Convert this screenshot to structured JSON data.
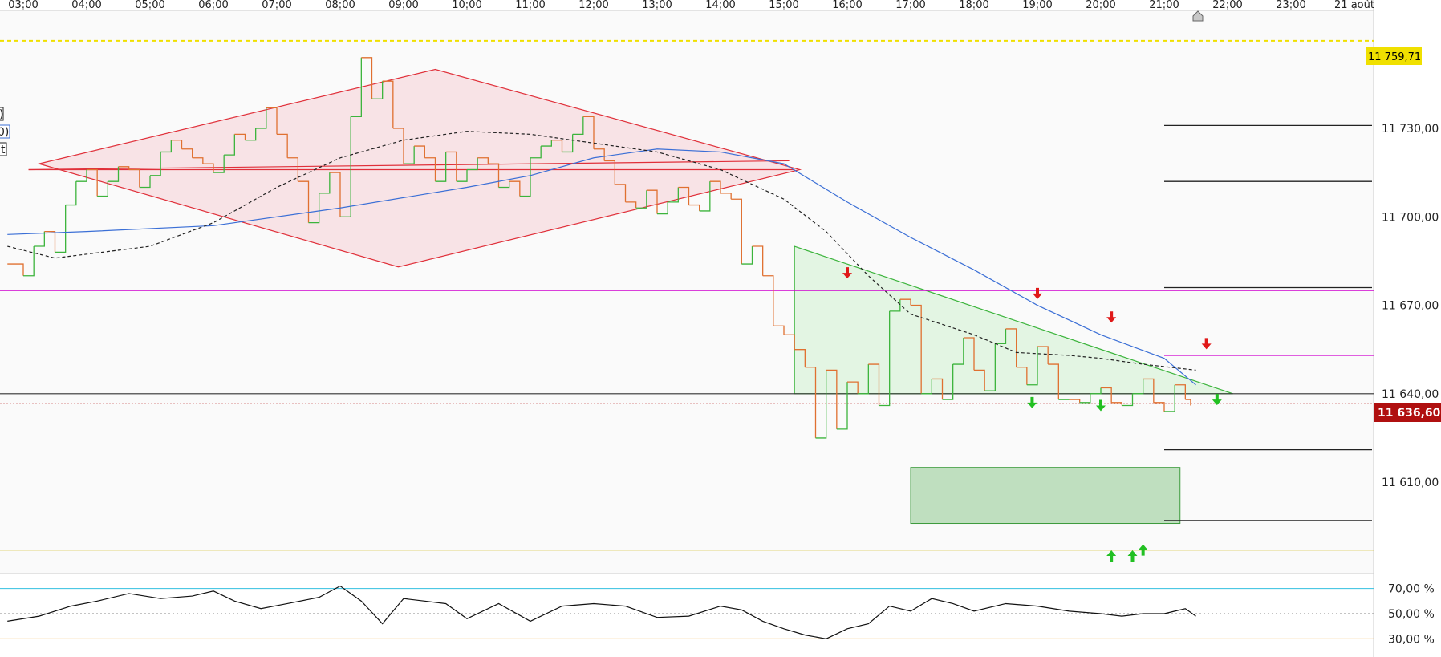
{
  "chart_data": {
    "type": "line",
    "time_axis": {
      "ticks": [
        "03:00",
        "04:00",
        "05:00",
        "06:00",
        "07:00",
        "08:00",
        "09:00",
        "10:00",
        "11:00",
        "12:00",
        "13:00",
        "14:00",
        "15:00",
        "16:00",
        "17:00",
        "18:00",
        "19:00",
        "20:00",
        "21:00",
        "22:00",
        "23:00",
        "21 août"
      ]
    },
    "price_axis": {
      "ticks": [
        "11 730,00",
        "11 700,00",
        "11 670,00",
        "11 640,00",
        "11 610,00"
      ],
      "ylim": [
        11579,
        11770
      ]
    },
    "markers": {
      "current_price": "11 636,60",
      "current_price_color": "#b01010",
      "high_level": "11 759,71",
      "high_level_color": "#f0e000"
    },
    "left_legend": [
      ")",
      "0)",
      "t"
    ],
    "series": [
      {
        "name": "",
        "color": "#e07030",
        "up_color": "#3cb43c",
        "style": "step",
        "x": [
          "02:45",
          "03:00",
          "03:10",
          "03:20",
          "03:30",
          "03:40",
          "03:50",
          "04:00",
          "04:10",
          "04:20",
          "04:30",
          "04:40",
          "04:50",
          "05:00",
          "05:10",
          "05:20",
          "05:30",
          "05:40",
          "05:50",
          "06:00",
          "06:10",
          "06:20",
          "06:30",
          "06:40",
          "06:50",
          "07:00",
          "07:10",
          "07:20",
          "07:30",
          "07:40",
          "07:50",
          "08:00",
          "08:10",
          "08:20",
          "08:30",
          "08:40",
          "08:50",
          "09:00",
          "09:10",
          "09:20",
          "09:30",
          "09:40",
          "09:50",
          "10:00",
          "10:10",
          "10:20",
          "10:30",
          "10:40",
          "10:50",
          "11:00",
          "11:10",
          "11:20",
          "11:30",
          "11:40",
          "11:50",
          "12:00",
          "12:10",
          "12:20",
          "12:30",
          "12:40",
          "12:50",
          "13:00",
          "13:10",
          "13:20",
          "13:30",
          "13:40",
          "13:50",
          "14:00",
          "14:10",
          "14:20",
          "14:30",
          "14:40",
          "14:50",
          "15:00",
          "15:10",
          "15:20",
          "15:30",
          "15:40",
          "15:50",
          "16:00",
          "16:10",
          "16:20",
          "16:30",
          "16:40",
          "16:50",
          "17:00",
          "17:10",
          "17:20",
          "17:30",
          "17:40",
          "17:50",
          "18:00",
          "18:10",
          "18:20",
          "18:30",
          "18:40",
          "18:50",
          "19:00",
          "19:10",
          "19:20",
          "19:30",
          "19:40",
          "19:50",
          "20:00",
          "20:10",
          "20:20",
          "20:30",
          "20:40",
          "20:50",
          "21:00",
          "21:10",
          "21:20",
          "21:25"
        ],
        "y": [
          11684,
          11680,
          11690,
          11695,
          11688,
          11704,
          11712,
          11716,
          11707,
          11712,
          11717,
          11716,
          11710,
          11714,
          11722,
          11726,
          11723,
          11720,
          11718,
          11715,
          11721,
          11728,
          11726,
          11730,
          11737,
          11728,
          11720,
          11712,
          11698,
          11708,
          11715,
          11700,
          11734,
          11754,
          11740,
          11746,
          11730,
          11718,
          11724,
          11720,
          11712,
          11722,
          11712,
          11716,
          11720,
          11718,
          11710,
          11712,
          11707,
          11720,
          11724,
          11726,
          11722,
          11728,
          11734,
          11723,
          11719,
          11711,
          11705,
          11703,
          11709,
          11701,
          11705,
          11710,
          11704,
          11702,
          11712,
          11708,
          11706,
          11684,
          11690,
          11680,
          11663,
          11660,
          11655,
          11649,
          11625,
          11648,
          11628,
          11644,
          11640,
          11650,
          11636,
          11668,
          11672,
          11670,
          11640,
          11645,
          11638,
          11650,
          11659,
          11648,
          11641,
          11657,
          11662,
          11649,
          11643,
          11656,
          11650,
          11638,
          11638,
          11637,
          11640,
          11642,
          11637,
          11636,
          11640,
          11645,
          11637,
          11634,
          11643,
          11638,
          11636
        ]
      },
      {
        "name": "",
        "color": "#3b6fd6",
        "style": "line",
        "x": [
          "02:45",
          "04:00",
          "06:00",
          "08:00",
          "10:00",
          "11:00",
          "12:00",
          "13:00",
          "14:00",
          "15:00",
          "16:00",
          "17:00",
          "18:00",
          "19:00",
          "20:00",
          "21:00",
          "21:30"
        ],
        "y": [
          11694,
          11695,
          11697,
          11703,
          11710,
          11714,
          11720,
          11723,
          11722,
          11718,
          11705,
          11693,
          11682,
          11670,
          11660,
          11652,
          11643
        ]
      },
      {
        "name": "",
        "color": "#222222",
        "style": "dashed",
        "x": [
          "02:45",
          "03:30",
          "05:00",
          "06:00",
          "07:00",
          "08:00",
          "09:00",
          "10:00",
          "11:00",
          "12:00",
          "13:00",
          "14:00",
          "15:00",
          "15:40",
          "16:20",
          "17:00",
          "18:00",
          "18:40",
          "19:30",
          "20:00",
          "20:40",
          "21:30"
        ],
        "y": [
          11690,
          11686,
          11690,
          11698,
          11710,
          11720,
          11726,
          11729,
          11728,
          11725,
          11722,
          11716,
          11706,
          11695,
          11680,
          11667,
          11660,
          11654,
          11653,
          11652,
          11650,
          11648
        ]
      }
    ],
    "pattern_shapes": {
      "red_diamond": [
        [
          "03:15",
          11718
        ],
        [
          "09:30",
          11750
        ],
        [
          "15:15",
          11716
        ],
        [
          "08:55",
          11683
        ]
      ],
      "red_triangle_lines": [
        [
          [
            "03:05",
            11716
          ],
          [
            "15:10",
            11716
          ]
        ],
        [
          [
            "03:05",
            11716
          ],
          [
            "15:05",
            11719
          ]
        ]
      ],
      "green_triangle": [
        [
          "15:10",
          11690
        ],
        [
          "15:10",
          11640
        ],
        [
          "22:05",
          11640
        ]
      ],
      "green_box": [
        [
          "17:00",
          11615
        ],
        [
          "21:15",
          11596
        ]
      ]
    },
    "level_lines": [
      {
        "y": 11759.71,
        "color": "#f0e000",
        "dash": true
      },
      {
        "y": 11675,
        "color": "#d000d0",
        "dash": false
      },
      {
        "y": 11653,
        "color": "#d000d0",
        "dash": false,
        "from": "21:00"
      },
      {
        "y": 11640,
        "color": "#333333",
        "dash": false
      },
      {
        "y": 11636.6,
        "color": "#b01010",
        "dash": "dotted"
      },
      {
        "y": 11587,
        "color": "#c8b400",
        "dash": false
      }
    ],
    "projection_lines": [
      11731,
      11712,
      11676,
      11621,
      11597
    ],
    "arrows_down_red": [
      [
        "16:00",
        11681
      ],
      [
        "19:00",
        11674
      ],
      [
        "20:10",
        11666
      ],
      [
        "21:40",
        11657
      ]
    ],
    "arrows_down_green": [
      [
        "18:55",
        11637
      ],
      [
        "20:00",
        11636
      ],
      [
        "21:50",
        11638
      ]
    ],
    "arrows_up_green": [
      [
        "20:10",
        11585
      ],
      [
        "20:30",
        11585
      ],
      [
        "20:40",
        11587
      ]
    ],
    "oscillator": {
      "ticks": [
        "70,00 %",
        "50,00 %",
        "30,00 %"
      ],
      "ylim": [
        20,
        80
      ],
      "levels": [
        {
          "y": 70,
          "color": "#33c0e0"
        },
        {
          "y": 50,
          "color": "#888888",
          "dash": true
        },
        {
          "y": 30,
          "color": "#f0a020"
        }
      ],
      "x": [
        "02:45",
        "03:15",
        "03:45",
        "04:10",
        "04:40",
        "05:10",
        "05:40",
        "06:00",
        "06:20",
        "06:45",
        "07:10",
        "07:40",
        "08:00",
        "08:20",
        "08:40",
        "09:00",
        "09:20",
        "09:40",
        "10:00",
        "10:30",
        "11:00",
        "11:30",
        "12:00",
        "12:30",
        "13:00",
        "13:30",
        "14:00",
        "14:20",
        "14:40",
        "15:00",
        "15:20",
        "15:40",
        "16:00",
        "16:20",
        "16:40",
        "17:00",
        "17:20",
        "17:40",
        "18:00",
        "18:30",
        "19:00",
        "19:30",
        "20:00",
        "20:20",
        "20:40",
        "21:00",
        "21:10",
        "21:20",
        "21:30"
      ],
      "y": [
        44,
        48,
        56,
        60,
        66,
        62,
        64,
        68,
        60,
        54,
        58,
        63,
        72,
        60,
        42,
        62,
        60,
        58,
        46,
        58,
        44,
        56,
        58,
        56,
        47,
        48,
        56,
        53,
        44,
        38,
        33,
        30,
        38,
        42,
        56,
        52,
        62,
        58,
        52,
        58,
        56,
        52,
        50,
        48,
        50,
        50,
        52,
        54,
        48
      ]
    }
  }
}
